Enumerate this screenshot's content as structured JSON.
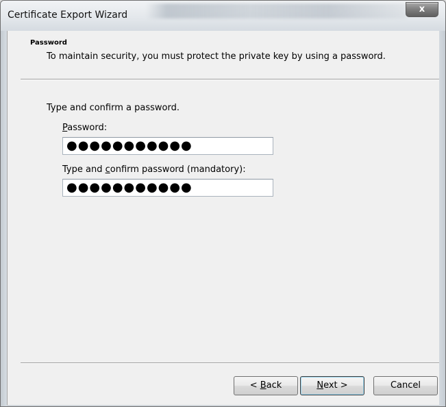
{
  "window": {
    "title": "Certificate Export Wizard",
    "close_glyph": "x"
  },
  "header": {
    "title": "Password",
    "subtitle": "To maintain security, you must protect the private key by using a password."
  },
  "form": {
    "instruction": "Type and confirm a password.",
    "password": {
      "label_access_key": "P",
      "label_rest": "assword:",
      "value_masked": "●●●●●●●●●●●"
    },
    "confirm": {
      "label_prefix": "Type and ",
      "label_access_key": "c",
      "label_rest": "onfirm password (mandatory):",
      "value_masked": "●●●●●●●●●●●"
    }
  },
  "buttons": {
    "back": {
      "prefix": "< ",
      "access_key": "B",
      "rest": "ack"
    },
    "next": {
      "access_key": "N",
      "rest": "ext >"
    },
    "cancel": {
      "label": "Cancel"
    }
  },
  "colors": {
    "client_background": "#f0f0f0",
    "close_button": "#7d7d7d"
  }
}
